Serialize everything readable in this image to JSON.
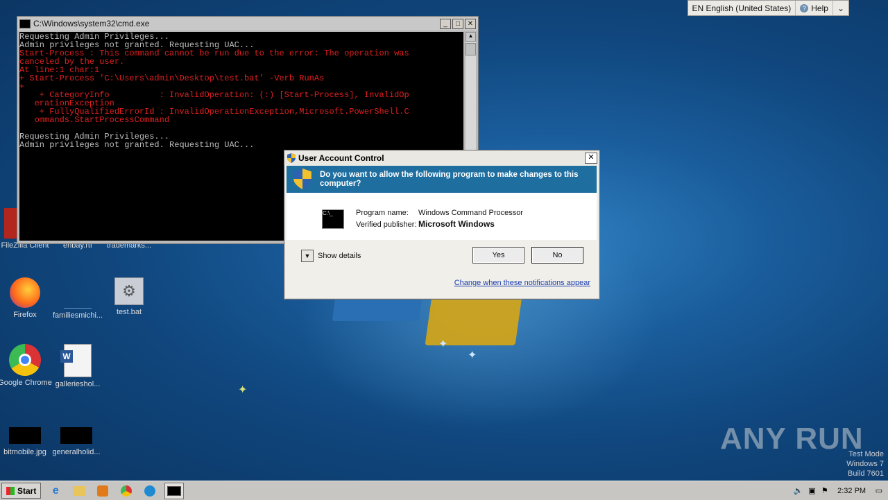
{
  "language_bar": {
    "language": "EN English (United States)",
    "help": "Help"
  },
  "cmd_window": {
    "title": "C:\\Windows\\system32\\cmd.exe",
    "lines": [
      {
        "text": "Requesting Admin Privileges...",
        "color": "gray"
      },
      {
        "text": "Admin privileges not granted. Requesting UAC...",
        "color": "gray"
      },
      {
        "text": "Start-Process : This command cannot be run due to the error: The operation was",
        "color": "red"
      },
      {
        "text": "canceled by the user.",
        "color": "red"
      },
      {
        "text": "At line:1 char:1",
        "color": "red"
      },
      {
        "text": "+ Start-Process 'C:\\Users\\admin\\Desktop\\test.bat' -Verb RunAs",
        "color": "red"
      },
      {
        "text": "+",
        "color": "red"
      },
      {
        "text": "    + CategoryInfo          : InvalidOperation: (:) [Start-Process], InvalidOp",
        "color": "red"
      },
      {
        "text": "   erationException",
        "color": "red"
      },
      {
        "text": "    + FullyQualifiedErrorId : InvalidOperationException,Microsoft.PowerShell.C",
        "color": "red"
      },
      {
        "text": "   ommands.StartProcessCommand",
        "color": "red"
      },
      {
        "text": " ",
        "color": "gray"
      },
      {
        "text": "Requesting Admin Privileges...",
        "color": "gray"
      },
      {
        "text": "Admin privileges not granted. Requesting UAC...",
        "color": "gray"
      }
    ]
  },
  "desktop_icons": [
    {
      "label": "FileZilla Client",
      "icon": "filezilla-icon"
    },
    {
      "label": "enbay.rtf",
      "icon": "rtf-file-icon"
    },
    {
      "label": "trademarks...",
      "icon": "file-icon"
    },
    {
      "label": "Firefox",
      "icon": "firefox-icon"
    },
    {
      "label": "familiesmichi...",
      "icon": "file-icon"
    },
    {
      "label": "test.bat",
      "icon": "batch-file-icon"
    },
    {
      "label": "Google Chrome",
      "icon": "chrome-icon"
    },
    {
      "label": "gallerieshol...",
      "icon": "word-doc-icon"
    },
    {
      "label": "bitmobile.jpg",
      "icon": "image-file-icon"
    },
    {
      "label": "generalholid...",
      "icon": "image-file-icon"
    }
  ],
  "uac": {
    "title": "User Account Control",
    "question": "Do you want to allow the following program to make changes to this computer?",
    "program_name_label": "Program name:",
    "program_name": "Windows Command Processor",
    "publisher_label": "Verified publisher:",
    "publisher": "Microsoft Windows",
    "show_details": "Show details",
    "yes": "Yes",
    "no": "No",
    "link": "Change when these notifications appear"
  },
  "watermark": "ANY RUN",
  "test_mode": {
    "line1": "Test Mode",
    "line2": "Windows 7",
    "line3": "Build 7601"
  },
  "taskbar": {
    "start": "Start",
    "clock": "2:32 PM"
  }
}
